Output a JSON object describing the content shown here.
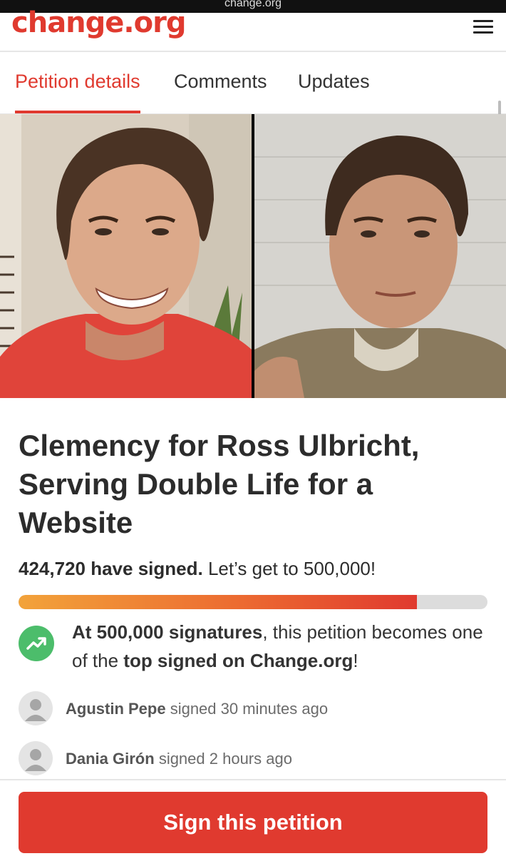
{
  "browser": {
    "url": "change.org"
  },
  "header": {
    "logo": "change.org",
    "menu_icon": "hamburger-menu-icon"
  },
  "tabs": [
    {
      "label": "Petition details",
      "active": true
    },
    {
      "label": "Comments",
      "active": false
    },
    {
      "label": "Updates",
      "active": false
    }
  ],
  "petition": {
    "title": "Clemency for Ross Ulbricht, Serving Double Life for a Website",
    "signed_count": "424,720 have signed.",
    "goal_text": "Let’s get to 500,000!",
    "progress_fraction": 0.8494,
    "progress_colors": [
      "#f2a33a",
      "#e03a2f"
    ],
    "milestone": {
      "icon": "trending-up-icon",
      "bold1": "At 500,000 signatures",
      "text1": ", this petition becomes one of the ",
      "bold2": "top signed on Change.org",
      "text2": "!"
    }
  },
  "signers": [
    {
      "name": "Agustin Pepe",
      "action": "signed 30 minutes ago"
    },
    {
      "name": "Dania Girón",
      "action": "signed 2 hours ago"
    }
  ],
  "cta": {
    "label": "Sign this petition"
  },
  "colors": {
    "brand": "#e03a2f",
    "trend_green": "#4cbd6b",
    "text": "#2c2c2c"
  }
}
